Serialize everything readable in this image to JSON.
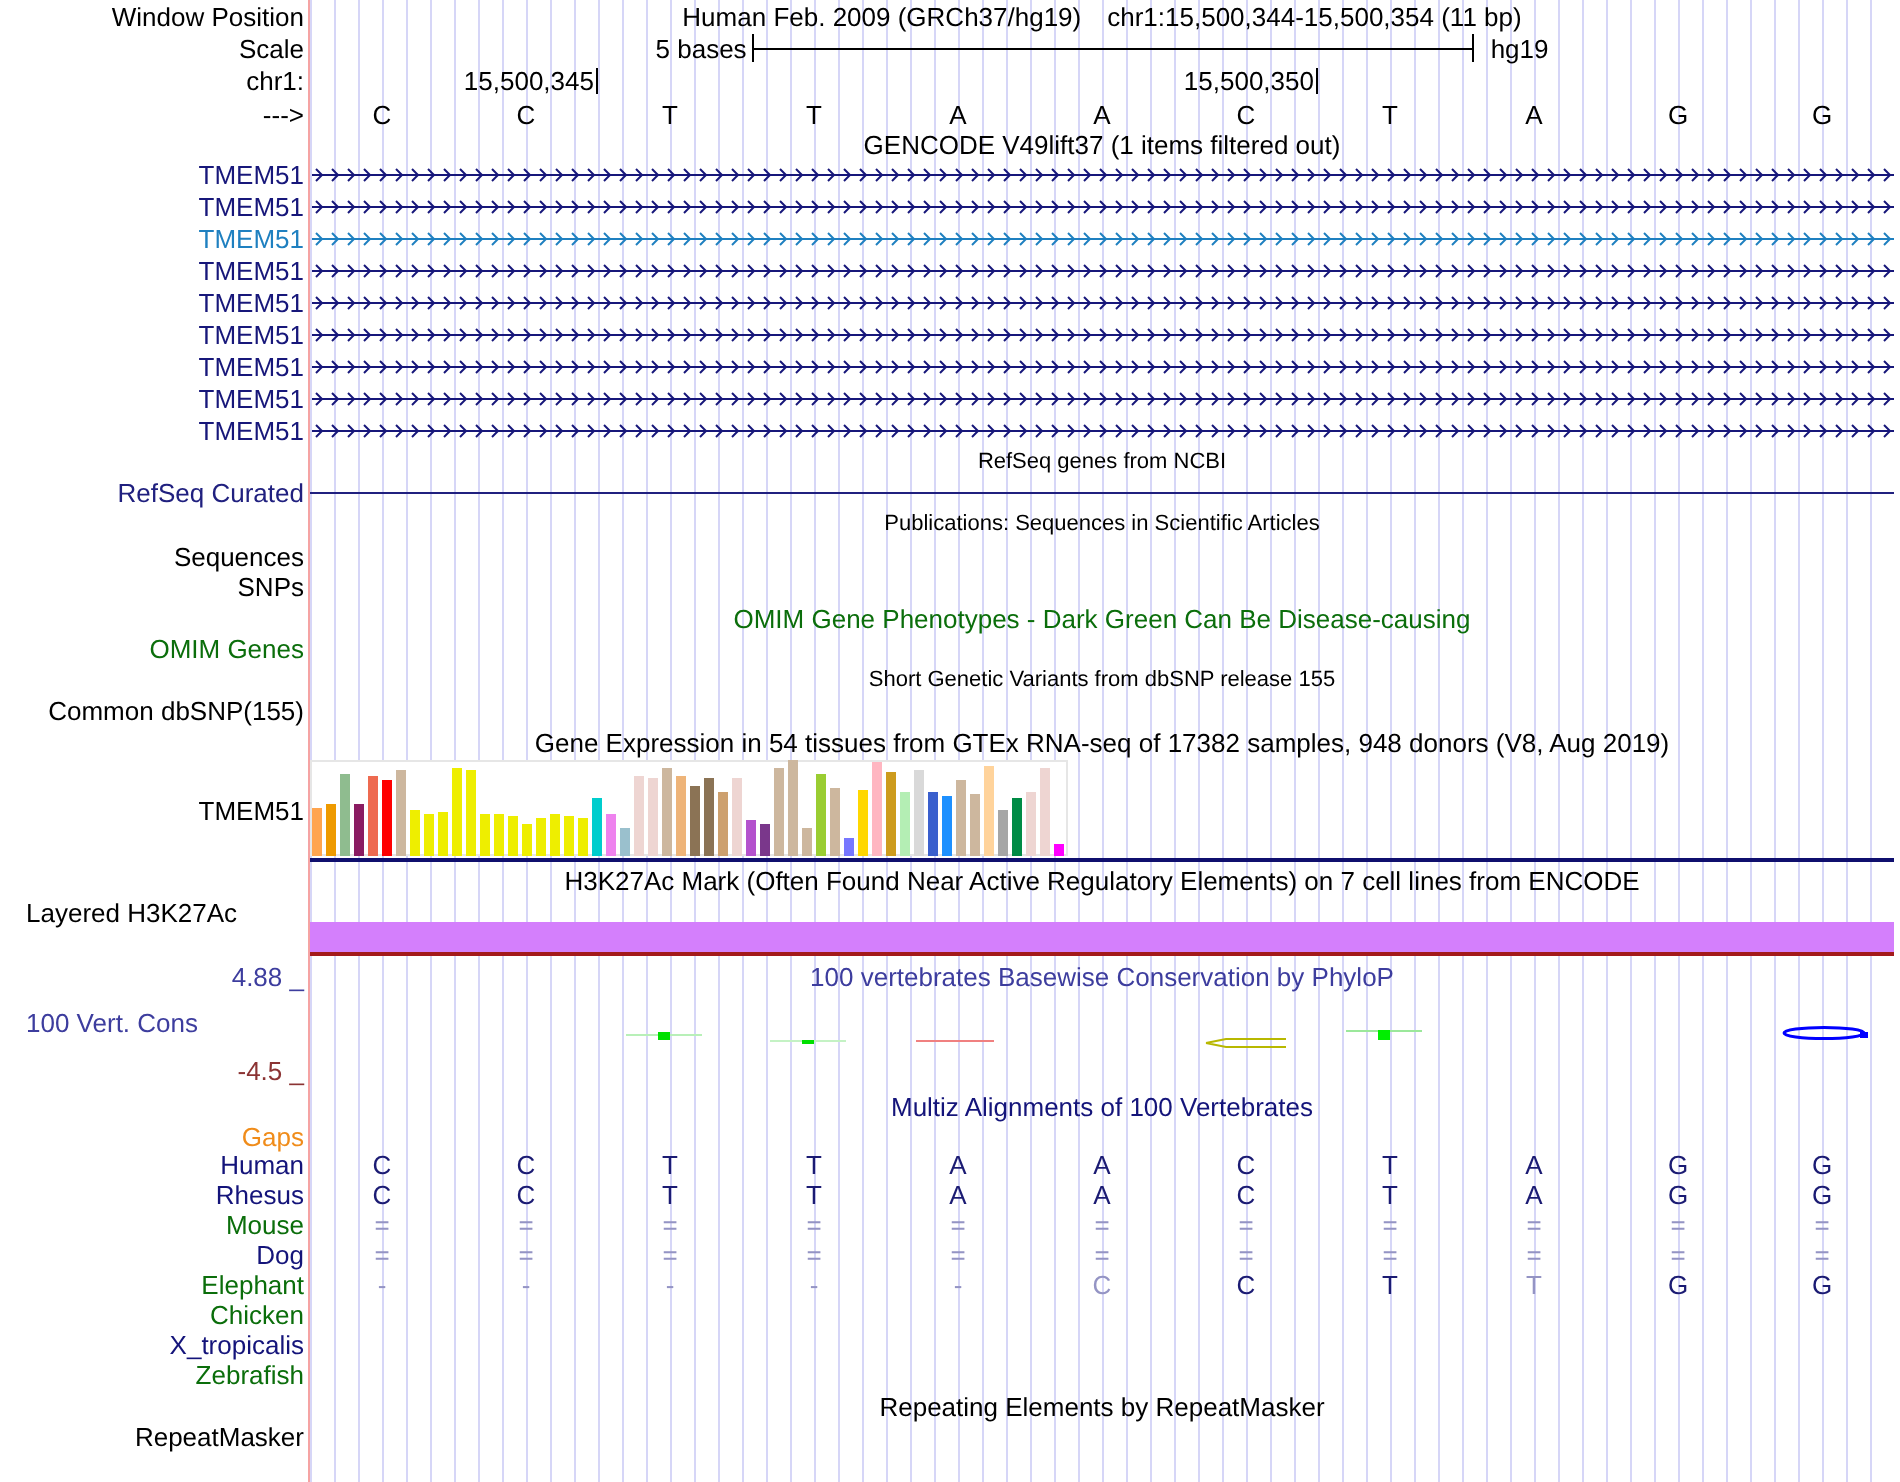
{
  "header": {
    "label": "Window Position",
    "assembly": "Human Feb. 2009 (GRCh37/hg19)",
    "range": "chr1:15,500,344-15,500,354 (11 bp)"
  },
  "scale": {
    "label": "Scale",
    "length": "5 bases",
    "assembly": "hg19"
  },
  "coordinates": {
    "label": "chr1:",
    "ticks": [
      "15,500,345",
      "15,500,350"
    ]
  },
  "sequence": {
    "label": "--->",
    "bases": [
      "C",
      "C",
      "T",
      "T",
      "A",
      "A",
      "C",
      "T",
      "A",
      "G",
      "G"
    ]
  },
  "tracks": [
    {
      "kind": "genes",
      "title": "GENCODE V49lift37 (1 items filtered out)",
      "color": "#000000",
      "items": [
        {
          "name": "TMEM51",
          "color": "#17177a"
        },
        {
          "name": "TMEM51",
          "color": "#17177a"
        },
        {
          "name": "TMEM51",
          "color": "#1f80c0"
        },
        {
          "name": "TMEM51",
          "color": "#17177a"
        },
        {
          "name": "TMEM51",
          "color": "#17177a"
        },
        {
          "name": "TMEM51",
          "color": "#17177a"
        },
        {
          "name": "TMEM51",
          "color": "#17177a"
        },
        {
          "name": "TMEM51",
          "color": "#17177a"
        },
        {
          "name": "TMEM51",
          "color": "#17177a"
        }
      ]
    },
    {
      "kind": "refseq",
      "title": "RefSeq genes from NCBI",
      "color": "#000000",
      "labels": [
        {
          "text": "RefSeq Curated",
          "color": "#20207f"
        }
      ]
    },
    {
      "kind": "publications",
      "title": "Publications: Sequences in Scientific Articles",
      "color": "#000000",
      "labels": [
        {
          "text": "Sequences",
          "color": "#000000"
        },
        {
          "text": "SNPs",
          "color": "#000000"
        }
      ]
    },
    {
      "kind": "omim",
      "title": "OMIM Gene Phenotypes - Dark Green Can Be Disease-causing",
      "color": "#0b6e0b",
      "labels": [
        {
          "text": "OMIM Genes",
          "color": "#0b6e0b"
        }
      ]
    },
    {
      "kind": "variants",
      "title": "Short Genetic Variants from dbSNP release 155",
      "color": "#000000",
      "labels": [
        {
          "text": "Common dbSNP(155)",
          "color": "#000000"
        }
      ]
    },
    {
      "kind": "expression",
      "title": "Gene Expression in 54 tissues from GTEx RNA-seq of 17382 samples, 948 donors (V8, Aug 2019)",
      "color": "#000000",
      "labels": [
        {
          "text": "TMEM51",
          "color": "#000000"
        }
      ]
    },
    {
      "kind": "signal",
      "title": "H3K27Ac Mark (Often Found Near Active Regulatory Elements) on 7 cell lines from ENCODE",
      "color": "#000000",
      "labels": [
        {
          "text": "Layered H3K27Ac",
          "color": "#000000"
        }
      ]
    },
    {
      "kind": "conservation",
      "title": "100 vertebrates Basewise Conservation by PhyloP",
      "color": "#3d3d9e",
      "labels": [
        {
          "text": "4.88 _",
          "color": "#3d3d9e"
        },
        {
          "text": "100 Vert. Cons",
          "color": "#3d3d9e"
        },
        {
          "text": "-4.5 _",
          "color": "#8b3333"
        }
      ]
    },
    {
      "kind": "alignment",
      "title": "Multiz Alignments of 100 Vertebrates",
      "color": "#14147a",
      "labels": [
        {
          "text": "Gaps",
          "color": "#f08c1a"
        }
      ],
      "species": [
        {
          "name": "Human",
          "color": "#14147a",
          "bases": [
            {
              "text": "C",
              "faint": false
            },
            {
              "text": "C",
              "faint": false
            },
            {
              "text": "T",
              "faint": false
            },
            {
              "text": "T",
              "faint": false
            },
            {
              "text": "A",
              "faint": false
            },
            {
              "text": "A",
              "faint": false
            },
            {
              "text": "C",
              "faint": false
            },
            {
              "text": "T",
              "faint": false
            },
            {
              "text": "A",
              "faint": false
            },
            {
              "text": "G",
              "faint": false
            },
            {
              "text": "G",
              "faint": false
            }
          ]
        },
        {
          "name": "Rhesus",
          "color": "#14147a",
          "bases": [
            {
              "text": "C",
              "faint": false
            },
            {
              "text": "C",
              "faint": false
            },
            {
              "text": "T",
              "faint": false
            },
            {
              "text": "T",
              "faint": false
            },
            {
              "text": "A",
              "faint": false
            },
            {
              "text": "A",
              "faint": false
            },
            {
              "text": "C",
              "faint": false
            },
            {
              "text": "T",
              "faint": false
            },
            {
              "text": "A",
              "faint": false
            },
            {
              "text": "G",
              "faint": false
            },
            {
              "text": "G",
              "faint": false
            }
          ]
        },
        {
          "name": "Mouse",
          "color": "#0b6e0b",
          "bases": [
            {
              "text": "=",
              "faint": true
            },
            {
              "text": "=",
              "faint": true
            },
            {
              "text": "=",
              "faint": true
            },
            {
              "text": "=",
              "faint": true
            },
            {
              "text": "=",
              "faint": true
            },
            {
              "text": "=",
              "faint": true
            },
            {
              "text": "=",
              "faint": true
            },
            {
              "text": "=",
              "faint": true
            },
            {
              "text": "=",
              "faint": true
            },
            {
              "text": "=",
              "faint": true
            },
            {
              "text": "=",
              "faint": true
            }
          ]
        },
        {
          "name": "Dog",
          "color": "#14147a",
          "bases": [
            {
              "text": "=",
              "faint": true
            },
            {
              "text": "=",
              "faint": true
            },
            {
              "text": "=",
              "faint": true
            },
            {
              "text": "=",
              "faint": true
            },
            {
              "text": "=",
              "faint": true
            },
            {
              "text": "=",
              "faint": true
            },
            {
              "text": "=",
              "faint": true
            },
            {
              "text": "=",
              "faint": true
            },
            {
              "text": "=",
              "faint": true
            },
            {
              "text": "=",
              "faint": true
            },
            {
              "text": "=",
              "faint": true
            }
          ]
        },
        {
          "name": "Elephant",
          "color": "#0b6e0b",
          "bases": [
            {
              "text": "-",
              "faint": true
            },
            {
              "text": "-",
              "faint": true
            },
            {
              "text": "-",
              "faint": true
            },
            {
              "text": "-",
              "faint": true
            },
            {
              "text": "-",
              "faint": true
            },
            {
              "text": "C",
              "faint": true
            },
            {
              "text": "C",
              "faint": false
            },
            {
              "text": "T",
              "faint": false
            },
            {
              "text": "T",
              "faint": true
            },
            {
              "text": "G",
              "faint": false
            },
            {
              "text": "G",
              "faint": false
            }
          ]
        },
        {
          "name": "Chicken",
          "color": "#0b6e0b"
        },
        {
          "name": "X_tropicalis",
          "color": "#14147a"
        },
        {
          "name": "Zebrafish",
          "color": "#0b6e0b"
        }
      ]
    },
    {
      "kind": "repeats",
      "title": "Repeating Elements by RepeatMasker",
      "color": "#000000",
      "labels": [
        {
          "text": "RepeatMasker",
          "color": "#000000"
        }
      ]
    }
  ]
}
